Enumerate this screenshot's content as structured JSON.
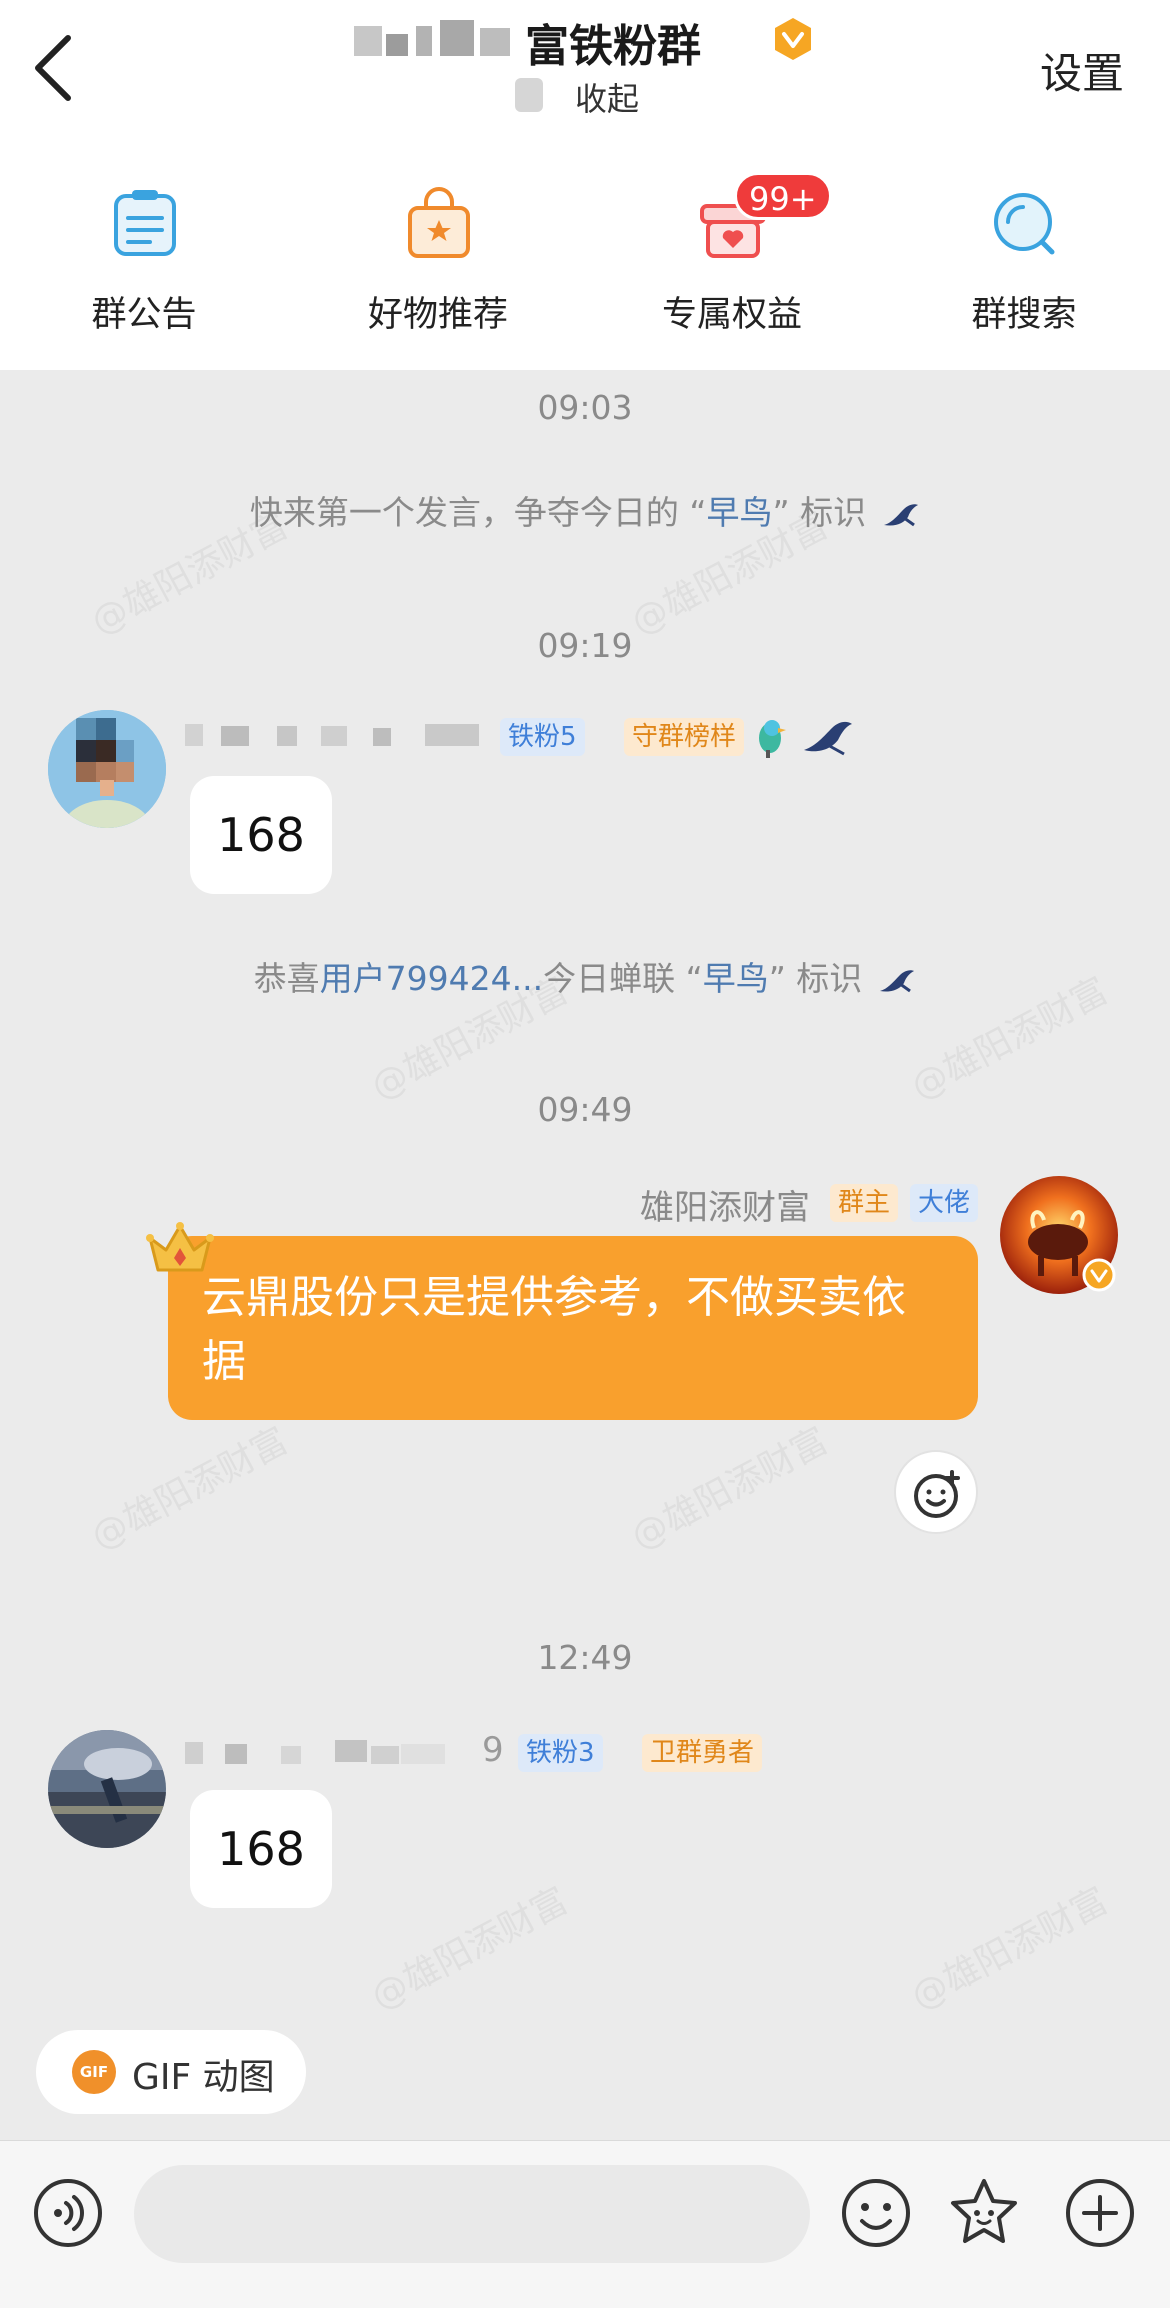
{
  "header": {
    "title": "富铁粉群",
    "subtitle": "收起",
    "settings_label": "设置"
  },
  "quick_actions": [
    {
      "label": "群公告",
      "icon": "announcement-icon"
    },
    {
      "label": "好物推荐",
      "icon": "shopping-bag-icon"
    },
    {
      "label": "专属权益",
      "icon": "gift-icon",
      "badge": "99+"
    },
    {
      "label": "群搜索",
      "icon": "search-icon"
    }
  ],
  "watermark": "@雄阳添财富",
  "messages": {
    "time_1": "09:03",
    "system_1": {
      "text": "快来第一个发言，争夺今日的 “早鸟” 标识",
      "prefix": "快来第一个发言，争夺今日的 “",
      "highlight": "早鸟",
      "suffix": "” 标识"
    },
    "time_2": "09:19",
    "msg_1": {
      "tag_1": "铁粉5",
      "tag_2": "守群榜样",
      "text": "168"
    },
    "system_2": {
      "prefix": "恭喜",
      "user": "用户799424...",
      "middle": "今日蝉联 “",
      "highlight": "早鸟",
      "suffix": "” 标识"
    },
    "time_3": "09:49",
    "msg_2": {
      "sender": "雄阳添财富",
      "tag_1": "群主",
      "tag_2": "大佬",
      "text": "云鼎股份只是提供参考，不做买卖依据"
    },
    "time_4": "12:49",
    "msg_3": {
      "name_tail": "9",
      "tag_1": "铁粉3",
      "tag_2": "卫群勇者",
      "text": "168"
    }
  },
  "composer": {
    "gif_icon_text": "GIF",
    "gif_label": "GIF 动图",
    "input_placeholder": ""
  },
  "colors": {
    "accent_orange": "#f9a02d",
    "tag_blue": "#3f7fd8",
    "tag_orange": "#e0871a",
    "badge_red": "#ef3b3b",
    "highlight_blue": "#4f7bb0"
  }
}
